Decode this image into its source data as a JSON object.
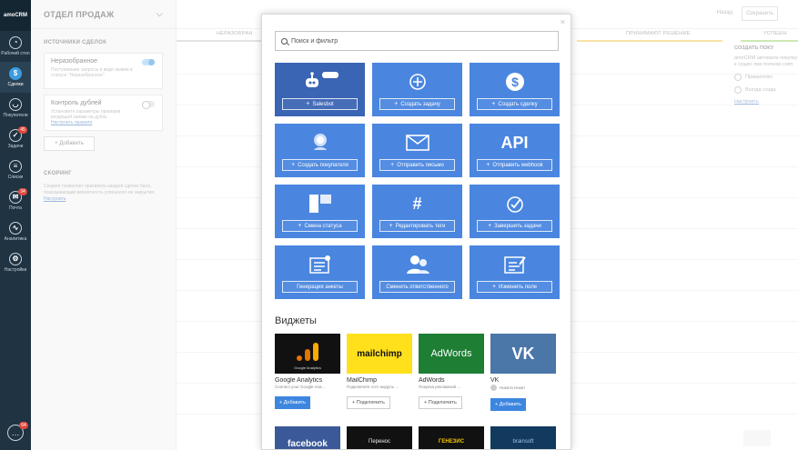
{
  "nav": {
    "logo": "amoCRM",
    "items": [
      {
        "label": "Рабочий стол",
        "badge": ""
      },
      {
        "label": "Сделки",
        "badge": ""
      },
      {
        "label": "Покупатели",
        "badge": ""
      },
      {
        "label": "Задачи",
        "badge": "45"
      },
      {
        "label": "Списки",
        "badge": ""
      },
      {
        "label": "Почта",
        "badge": "34"
      },
      {
        "label": "Аналитика",
        "badge": ""
      },
      {
        "label": "Настройки",
        "badge": ""
      }
    ],
    "chat_badge": "64"
  },
  "sidebar": {
    "title": "ОТДЕЛ ПРОДАЖ",
    "sources_title": "ИСТОЧНИКИ СДЕЛОК",
    "card1": {
      "title": "Неразобранное",
      "desc": "Поступившие запросы в виде заявок в статусе \"Неразобранное\""
    },
    "card2": {
      "title": "Контроль дублей",
      "desc": "Установите параметры проверки входящей заявки на дубль",
      "link": "Настроить правила"
    },
    "add": "+ Добавить",
    "scoring_title": "СКОРИНГ",
    "scoring_desc": "Скоринг позволяет присвоить каждой сделке балл, показывающий вероятность успешного ее закрытия",
    "scoring_link": "Настроить"
  },
  "board": {
    "back": "Назад",
    "save": "Сохранить",
    "stages": [
      "НЕРАЗОБРАН",
      "ПРИНИМАЮТ РЕШЕНИЕ",
      "УСПЕШН"
    ],
    "right_panel": {
      "title": "СОЗДАТЬ ПОКУ",
      "text": "amoCRM автомати покупку к сущес при полном совп",
      "opt1": "Прикреплят",
      "opt2": "Всегда созда",
      "link": "Настроить"
    }
  },
  "modal": {
    "search_placeholder": "Поиск и фильтр",
    "tiles": [
      {
        "label": "Salesbot",
        "icon": "robot-icon"
      },
      {
        "label": "Создать задачу",
        "icon": "plus-circle-icon"
      },
      {
        "label": "Создать сделку",
        "icon": "dollar-icon"
      },
      {
        "label": "Создать покупателя",
        "icon": "customer-icon"
      },
      {
        "label": "Отправить письмо",
        "icon": "envelope-icon"
      },
      {
        "label": "Отправить webhook",
        "icon": "api-icon",
        "icon_text": "API"
      },
      {
        "label": "Смена статуса",
        "icon": "status-icon"
      },
      {
        "label": "Редактировать теги",
        "icon": "hash-icon",
        "icon_text": "#"
      },
      {
        "label": "Завершить задачи",
        "icon": "check-circle-icon"
      },
      {
        "label": "Генерация анкеты",
        "icon": "form-icon"
      },
      {
        "label": "Сменить ответственного",
        "icon": "people-icon"
      },
      {
        "label": "Изменить поле",
        "icon": "edit-field-icon"
      }
    ],
    "widgets_title": "Виджеты",
    "widgets": [
      {
        "name": "Google Analytics",
        "desc": "Connect your Google Ana...",
        "button": "+ Добавить",
        "thumb_text": "Google Analytics",
        "color": "#111111"
      },
      {
        "name": "MailChimp",
        "desc": "Подключите этот модуль ...",
        "button": "+ Подключить",
        "thumb_text": "mailchimp",
        "color": "#ffe01b"
      },
      {
        "name": "AdWords",
        "desc": "Покупка рекламной ...",
        "button": "+ Подключить",
        "thumb_text": "AdWords",
        "color": "#1e7e34"
      },
      {
        "name": "VK",
        "desc": "Никита Никит",
        "button": "+ Добавить",
        "thumb_text": "VK",
        "color": "#4a76a8"
      }
    ],
    "widgets_row2": [
      {
        "thumb_text": "facebook",
        "color": "#3b5998"
      },
      {
        "thumb_text": "Перенос",
        "color": "#111111"
      },
      {
        "thumb_text": "ГЕНЕЗИС",
        "color": "#111111"
      },
      {
        "thumb_text": "brainsoft",
        "color": "#123a5e"
      }
    ]
  }
}
